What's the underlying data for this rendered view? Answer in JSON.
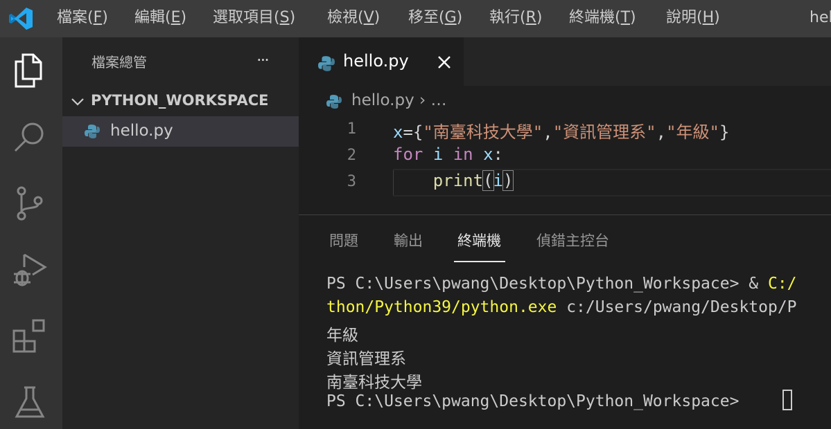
{
  "titlebar": {
    "menus": [
      {
        "text": "檔案(",
        "mnemonic": "F",
        "close": ")"
      },
      {
        "text": "編輯(",
        "mnemonic": "E",
        "close": ")"
      },
      {
        "text": "選取項目(",
        "mnemonic": "S",
        "close": ")"
      },
      {
        "text": "檢視(",
        "mnemonic": "V",
        "close": ")"
      },
      {
        "text": "移至(",
        "mnemonic": "G",
        "close": ")"
      },
      {
        "text": "執行(",
        "mnemonic": "R",
        "close": ")"
      },
      {
        "text": "終端機(",
        "mnemonic": "T",
        "close": ")"
      },
      {
        "text": "說明(",
        "mnemonic": "H",
        "close": ")"
      }
    ],
    "window_title": "hel"
  },
  "activitybar": {
    "icons": [
      "explorer-icon",
      "search-icon",
      "source-control-icon",
      "run-debug-icon",
      "extensions-icon",
      "testing-icon"
    ]
  },
  "sidebar": {
    "title": "檔案總管",
    "more": "···",
    "folder": "PYTHON_WORKSPACE",
    "file": "hello.py"
  },
  "editor": {
    "tab_label": "hello.py",
    "breadcrumb": "hello.py › …",
    "line_numbers": [
      "1",
      "2",
      "3"
    ],
    "code": {
      "line1": {
        "a": "x",
        "b": "={",
        "s1": "\"南臺科技大學\"",
        "c1": ",",
        "s2": "\"資訊管理系\"",
        "c2": ",",
        "s3": "\"年級\"",
        "d": "}"
      },
      "line2": {
        "kw1": "for",
        "v1": "i",
        "kw2": "in",
        "v2": "x",
        "p": ":"
      },
      "line3": {
        "indent": "    ",
        "fn": "print",
        "lp": "(",
        "v": "i",
        "rp": ")"
      }
    }
  },
  "panel": {
    "tabs": [
      "問題",
      "輸出",
      "終端機",
      "偵錯主控台"
    ],
    "active_tab": "終端機",
    "terminal": {
      "line1_prompt": "PS C:\\Users\\pwang\\Desktop\\Python_Workspace> & ",
      "line1_cmd": "C:/",
      "line2_cmd": "thon/Python39/python.exe",
      "line2_arg": " c:/Users/pwang/Desktop/P",
      "out1": "年級",
      "out2": "資訊管理系",
      "out3": "南臺科技大學",
      "prompt": "PS C:\\Users\\pwang\\Desktop\\Python_Workspace> "
    }
  },
  "colors": {
    "titlebar": "#3c3c3c",
    "activitybar": "#333333",
    "sidebar": "#252526",
    "editor": "#1e1e1e",
    "selected_file": "#37373d",
    "terminal_command": "#f5f543"
  }
}
